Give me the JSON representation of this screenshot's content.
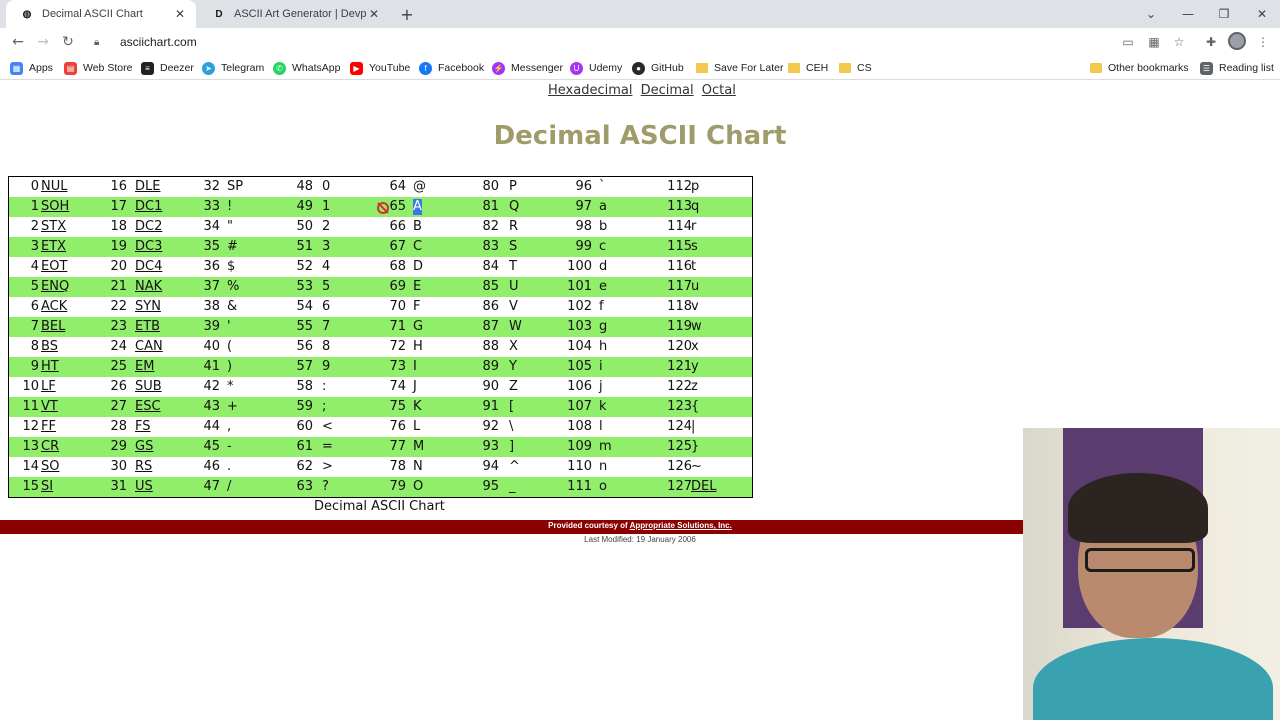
{
  "browser": {
    "tabs": [
      {
        "title": "Decimal ASCII Chart",
        "favicon": "globe-icon"
      },
      {
        "title": "ASCII Art Generator | Devpost",
        "favicon": "D"
      }
    ],
    "address": "asciichart.com",
    "bookmarks": [
      {
        "label": "Apps"
      },
      {
        "label": "Web Store"
      },
      {
        "label": "Deezer"
      },
      {
        "label": "Telegram"
      },
      {
        "label": "WhatsApp"
      },
      {
        "label": "YouTube"
      },
      {
        "label": "Facebook"
      },
      {
        "label": "Messenger"
      },
      {
        "label": "Udemy"
      },
      {
        "label": "GitHub"
      },
      {
        "label": "Save For Later"
      },
      {
        "label": "CEH"
      },
      {
        "label": "CS"
      }
    ],
    "other_bookmarks": "Other bookmarks",
    "reading_list": "Reading list"
  },
  "page": {
    "nav": [
      "Hexadecimal",
      "Decimal",
      "Octal"
    ],
    "title": "Decimal ASCII Chart",
    "caption": "Decimal ASCII Chart",
    "footer_prefix": "Provided courtesy of ",
    "footer_link": "Appropriate Solutions, Inc.",
    "last_modified": "Last Modified: 19 January 2006"
  },
  "ascii_rows": [
    [
      [
        "0",
        "NUL"
      ],
      [
        "16",
        "DLE"
      ],
      [
        "32",
        "SP"
      ],
      [
        "48",
        "0"
      ],
      [
        "64",
        "@"
      ],
      [
        "80",
        "P"
      ],
      [
        "96",
        "`"
      ],
      [
        "112",
        "p"
      ]
    ],
    [
      [
        "1",
        "SOH"
      ],
      [
        "17",
        "DC1"
      ],
      [
        "33",
        "!"
      ],
      [
        "49",
        "1"
      ],
      [
        "65",
        "A"
      ],
      [
        "81",
        "Q"
      ],
      [
        "97",
        "a"
      ],
      [
        "113",
        "q"
      ]
    ],
    [
      [
        "2",
        "STX"
      ],
      [
        "18",
        "DC2"
      ],
      [
        "34",
        "\""
      ],
      [
        "50",
        "2"
      ],
      [
        "66",
        "B"
      ],
      [
        "82",
        "R"
      ],
      [
        "98",
        "b"
      ],
      [
        "114",
        "r"
      ]
    ],
    [
      [
        "3",
        "ETX"
      ],
      [
        "19",
        "DC3"
      ],
      [
        "35",
        "#"
      ],
      [
        "51",
        "3"
      ],
      [
        "67",
        "C"
      ],
      [
        "83",
        "S"
      ],
      [
        "99",
        "c"
      ],
      [
        "115",
        "s"
      ]
    ],
    [
      [
        "4",
        "EOT"
      ],
      [
        "20",
        "DC4"
      ],
      [
        "36",
        "$"
      ],
      [
        "52",
        "4"
      ],
      [
        "68",
        "D"
      ],
      [
        "84",
        "T"
      ],
      [
        "100",
        "d"
      ],
      [
        "116",
        "t"
      ]
    ],
    [
      [
        "5",
        "ENQ"
      ],
      [
        "21",
        "NAK"
      ],
      [
        "37",
        "%"
      ],
      [
        "53",
        "5"
      ],
      [
        "69",
        "E"
      ],
      [
        "85",
        "U"
      ],
      [
        "101",
        "e"
      ],
      [
        "117",
        "u"
      ]
    ],
    [
      [
        "6",
        "ACK"
      ],
      [
        "22",
        "SYN"
      ],
      [
        "38",
        "&"
      ],
      [
        "54",
        "6"
      ],
      [
        "70",
        "F"
      ],
      [
        "86",
        "V"
      ],
      [
        "102",
        "f"
      ],
      [
        "118",
        "v"
      ]
    ],
    [
      [
        "7",
        "BEL"
      ],
      [
        "23",
        "ETB"
      ],
      [
        "39",
        "'"
      ],
      [
        "55",
        "7"
      ],
      [
        "71",
        "G"
      ],
      [
        "87",
        "W"
      ],
      [
        "103",
        "g"
      ],
      [
        "119",
        "w"
      ]
    ],
    [
      [
        "8",
        "BS"
      ],
      [
        "24",
        "CAN"
      ],
      [
        "40",
        "("
      ],
      [
        "56",
        "8"
      ],
      [
        "72",
        "H"
      ],
      [
        "88",
        "X"
      ],
      [
        "104",
        "h"
      ],
      [
        "120",
        "x"
      ]
    ],
    [
      [
        "9",
        "HT"
      ],
      [
        "25",
        "EM"
      ],
      [
        "41",
        ")"
      ],
      [
        "57",
        "9"
      ],
      [
        "73",
        "I"
      ],
      [
        "89",
        "Y"
      ],
      [
        "105",
        "i"
      ],
      [
        "121",
        "y"
      ]
    ],
    [
      [
        "10",
        "LF"
      ],
      [
        "26",
        "SUB"
      ],
      [
        "42",
        "*"
      ],
      [
        "58",
        ":"
      ],
      [
        "74",
        "J"
      ],
      [
        "90",
        "Z"
      ],
      [
        "106",
        "j"
      ],
      [
        "122",
        "z"
      ]
    ],
    [
      [
        "11",
        "VT"
      ],
      [
        "27",
        "ESC"
      ],
      [
        "43",
        "+"
      ],
      [
        "59",
        ";"
      ],
      [
        "75",
        "K"
      ],
      [
        "91",
        "["
      ],
      [
        "107",
        "k"
      ],
      [
        "123",
        "{"
      ]
    ],
    [
      [
        "12",
        "FF"
      ],
      [
        "28",
        "FS"
      ],
      [
        "44",
        ","
      ],
      [
        "60",
        "<"
      ],
      [
        "76",
        "L"
      ],
      [
        "92",
        "\\"
      ],
      [
        "108",
        "l"
      ],
      [
        "124",
        "|"
      ]
    ],
    [
      [
        "13",
        "CR"
      ],
      [
        "29",
        "GS"
      ],
      [
        "45",
        "-"
      ],
      [
        "61",
        "="
      ],
      [
        "77",
        "M"
      ],
      [
        "93",
        "]"
      ],
      [
        "109",
        "m"
      ],
      [
        "125",
        "}"
      ]
    ],
    [
      [
        "14",
        "SO"
      ],
      [
        "30",
        "RS"
      ],
      [
        "46",
        "."
      ],
      [
        "62",
        ">"
      ],
      [
        "78",
        "N"
      ],
      [
        "94",
        "^"
      ],
      [
        "110",
        "n"
      ],
      [
        "126",
        "~"
      ]
    ],
    [
      [
        "15",
        "SI"
      ],
      [
        "31",
        "US"
      ],
      [
        "47",
        "/"
      ],
      [
        "63",
        "?"
      ],
      [
        "79",
        "O"
      ],
      [
        "95",
        "_"
      ],
      [
        "111",
        "o"
      ],
      [
        "127",
        "DEL"
      ]
    ]
  ],
  "colors": {
    "row_highlight": "#90ee6a",
    "title": "#a09b6b",
    "footer_bar": "#8b0000"
  }
}
